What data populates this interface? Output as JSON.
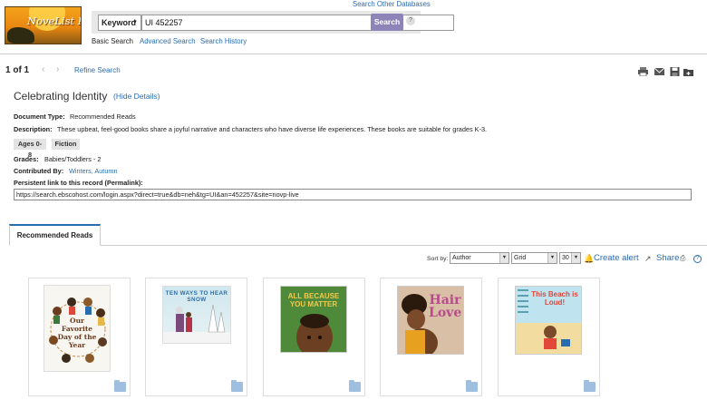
{
  "header": {
    "logo_text": "NoveList Plus",
    "search_other_databases": "Search Other Databases",
    "field_select": "Keyword",
    "query": "UI 452257",
    "search_button": "Search",
    "help_glyph": "?",
    "links": {
      "basic": "Basic Search",
      "advanced": "Advanced Search",
      "history": "Search History"
    }
  },
  "nav": {
    "page_count": "1 of 1",
    "prev_glyph": "‹",
    "next_glyph": "›",
    "refine": "Refine Search",
    "tool_icons": [
      "print-icon",
      "email-icon",
      "save-icon",
      "add-to-folder-icon"
    ]
  },
  "record": {
    "title": "Celebrating Identity",
    "hide_details": "(Hide Details)",
    "doc_type_label": "Document Type:",
    "doc_type": "Recommended Reads",
    "description_label": "Description:",
    "description": "These upbeat, feel-good books share a joyful narrative and characters who have diverse life experiences. These books are suitable for grades K-3.",
    "badges": [
      "Ages 0-8",
      "Fiction"
    ],
    "grades_label": "Grades:",
    "grades": "Babies/Toddlers - 2",
    "contributed_label": "Contributed By:",
    "contributed": "Winters, Autumn",
    "permalink_label": "Persistent link to this record (Permalink):",
    "permalink": "https://search.ebscohost.com/login.aspx?direct=true&db=neh&tg=UI&an=452257&site=novp-live"
  },
  "tabs": {
    "active": "Recommended Reads"
  },
  "toolbar": {
    "sort_label": "Sort by:",
    "sort_value": "Author",
    "view_value": "Grid",
    "per_page": "30",
    "arrow_glyph": "▼",
    "bell_glyph": "🔔",
    "create_alert": "Create alert",
    "share_glyph": "↗",
    "share": "Share",
    "print_glyph": "⎙",
    "help_glyph": "?"
  },
  "books": [
    {
      "cover_title": "Our Favorite Day of the Year",
      "colors": [
        "#f7f6f1",
        "#6b3b1f"
      ]
    },
    {
      "cover_title": "TEN WAYS TO HEAR SNOW",
      "colors": [
        "#cfe7ef",
        "#2e6fa6"
      ]
    },
    {
      "cover_title": "ALL BECAUSE YOU MATTER",
      "colors": [
        "#4a7a3a",
        "#f2c94c"
      ]
    },
    {
      "cover_title": "Hair Love",
      "colors": [
        "#c7a98f",
        "#b84a8e"
      ]
    },
    {
      "cover_title": "This Beach is Loud!",
      "colors": [
        "#f3e6c4",
        "#e2473a"
      ]
    }
  ]
}
